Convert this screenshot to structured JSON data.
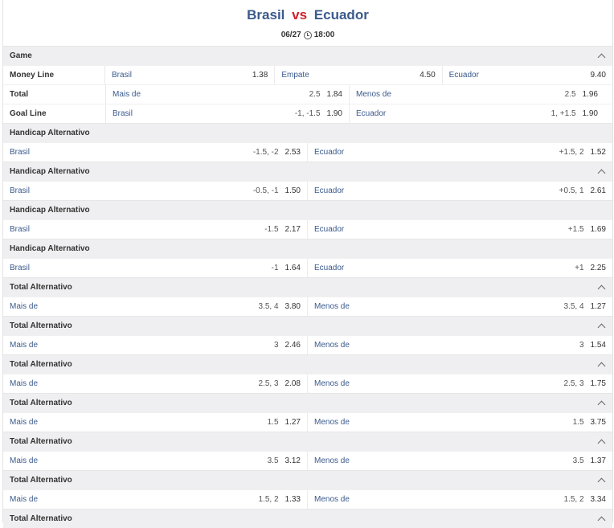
{
  "match": {
    "home": "Brasil",
    "vs": "vs",
    "away": "Ecuador",
    "date": "06/27",
    "time": "18:00"
  },
  "game_section": {
    "title": "Game"
  },
  "money_line": {
    "label": "Money Line",
    "options": [
      {
        "name": "Brasil",
        "price": "1.38"
      },
      {
        "name": "Empate",
        "price": "4.50"
      },
      {
        "name": "Ecuador",
        "price": "9.40"
      }
    ]
  },
  "total": {
    "label": "Total",
    "options": [
      {
        "name": "Mais de",
        "line": "2.5",
        "price": "1.84"
      },
      {
        "name": "Menos de",
        "line": "2.5",
        "price": "1.96"
      }
    ]
  },
  "goal_line": {
    "label": "Goal Line",
    "options": [
      {
        "name": "Brasil",
        "line": "-1, -1.5",
        "price": "1.90"
      },
      {
        "name": "Ecuador",
        "line": "1, +1.5",
        "price": "1.90"
      }
    ]
  },
  "markets": [
    {
      "title": "Handicap Alternativo",
      "left": {
        "name": "Brasil",
        "line": "-1.5, -2",
        "price": "2.53"
      },
      "right": {
        "name": "Ecuador",
        "line": "+1.5, 2",
        "price": "1.52"
      }
    },
    {
      "title": "Handicap Alternativo",
      "left": {
        "name": "Brasil",
        "line": "-0.5, -1",
        "price": "1.50"
      },
      "right": {
        "name": "Ecuador",
        "line": "+0.5, 1",
        "price": "2.61"
      }
    },
    {
      "title": "Handicap Alternativo",
      "left": {
        "name": "Brasil",
        "line": "-1.5",
        "price": "2.17"
      },
      "right": {
        "name": "Ecuador",
        "line": "+1.5",
        "price": "1.69"
      }
    },
    {
      "title": "Handicap Alternativo",
      "left": {
        "name": "Brasil",
        "line": "-1",
        "price": "1.64"
      },
      "right": {
        "name": "Ecuador",
        "line": "+1",
        "price": "2.25"
      }
    },
    {
      "title": "Total Alternativo",
      "left": {
        "name": "Mais de",
        "line": "3.5, 4",
        "price": "3.80"
      },
      "right": {
        "name": "Menos de",
        "line": "3.5, 4",
        "price": "1.27"
      }
    },
    {
      "title": "Total Alternativo",
      "left": {
        "name": "Mais de",
        "line": "3",
        "price": "2.46"
      },
      "right": {
        "name": "Menos de",
        "line": "3",
        "price": "1.54"
      }
    },
    {
      "title": "Total Alternativo",
      "left": {
        "name": "Mais de",
        "line": "2.5, 3",
        "price": "2.08"
      },
      "right": {
        "name": "Menos de",
        "line": "2.5, 3",
        "price": "1.75"
      }
    },
    {
      "title": "Total Alternativo",
      "left": {
        "name": "Mais de",
        "line": "1.5",
        "price": "1.27"
      },
      "right": {
        "name": "Menos de",
        "line": "1.5",
        "price": "3.75"
      }
    },
    {
      "title": "Total Alternativo",
      "left": {
        "name": "Mais de",
        "line": "3.5",
        "price": "3.12"
      },
      "right": {
        "name": "Menos de",
        "line": "3.5",
        "price": "1.37"
      }
    },
    {
      "title": "Total Alternativo",
      "left": {
        "name": "Mais de",
        "line": "1.5, 2",
        "price": "1.33"
      },
      "right": {
        "name": "Menos de",
        "line": "1.5, 2",
        "price": "3.34"
      }
    },
    {
      "title": "Total Alternativo"
    }
  ],
  "icons": {
    "collapse": "chevron-up-icon",
    "clock": "clock-icon"
  },
  "colors": {
    "team": "#3b5a8c",
    "vs": "#d0202c",
    "section_bg": "#efeff1"
  }
}
